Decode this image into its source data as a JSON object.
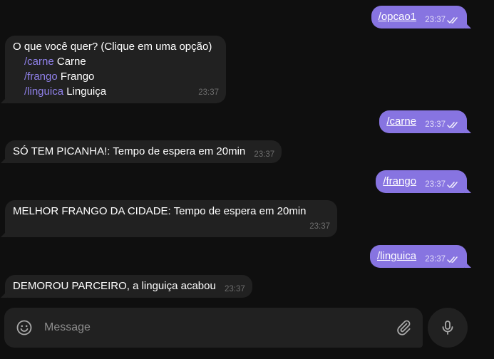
{
  "messages": {
    "m1": {
      "text": "/opcao1",
      "time": "23:37"
    },
    "m2": {
      "text": "O que você quer? (Clique em uma opção)",
      "options": [
        {
          "cmd": "/carne",
          "label": "Carne"
        },
        {
          "cmd": "/frango",
          "label": "Frango"
        },
        {
          "cmd": "/linguica",
          "label": "Linguiça"
        }
      ],
      "time": "23:37"
    },
    "m3": {
      "text": "/carne",
      "time": "23:37"
    },
    "m4": {
      "text": "SÓ TEM PICANHA!: Tempo de espera em 20min",
      "time": "23:37"
    },
    "m5": {
      "text": "/frango",
      "time": "23:37"
    },
    "m6": {
      "text": "MELHOR FRANGO DA CIDADE: Tempo de espera em 20min",
      "time": "23:37"
    },
    "m7": {
      "text": "/linguica",
      "time": "23:37"
    },
    "m8": {
      "text": "DEMOROU PARCEIRO, a linguiça acabou",
      "time": "23:37"
    }
  },
  "composer": {
    "placeholder": "Message"
  },
  "colors": {
    "background": "#0f0f0f",
    "incoming_bubble": "#212121",
    "outgoing_bubble": "#8774e1",
    "command_link": "#8f80e8"
  },
  "icons": {
    "read_receipt": "double-check-icon",
    "emoji": "smiley-icon",
    "attach": "paperclip-icon",
    "mic": "microphone-icon"
  }
}
